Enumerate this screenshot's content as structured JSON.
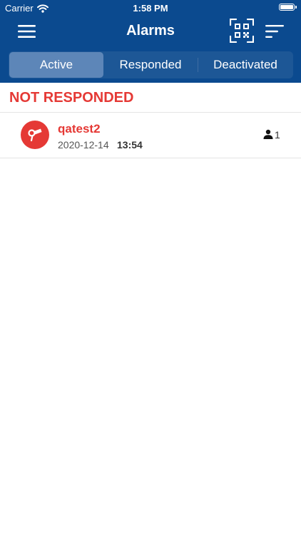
{
  "status_bar": {
    "carrier": "Carrier",
    "time": "1:58 PM"
  },
  "nav": {
    "title": "Alarms",
    "menu_icon": "hamburger-menu-icon",
    "qr_icon": "qr-scan-icon",
    "sort_icon": "sort-filter-icon"
  },
  "tabs": [
    {
      "label": "Active",
      "selected": true
    },
    {
      "label": "Responded",
      "selected": false
    },
    {
      "label": "Deactivated",
      "selected": false
    }
  ],
  "section": {
    "title": "NOT RESPONDED"
  },
  "alarms": [
    {
      "name": "qatest2",
      "date": "2020-12-14",
      "time": "13:54",
      "responders": "1",
      "icon": "alarm-device-icon"
    }
  ],
  "colors": {
    "header_bg": "#0b4a8f",
    "segment_bg": "#1d5796",
    "segment_selected": "#5d86b8",
    "alert_red": "#e53935"
  }
}
